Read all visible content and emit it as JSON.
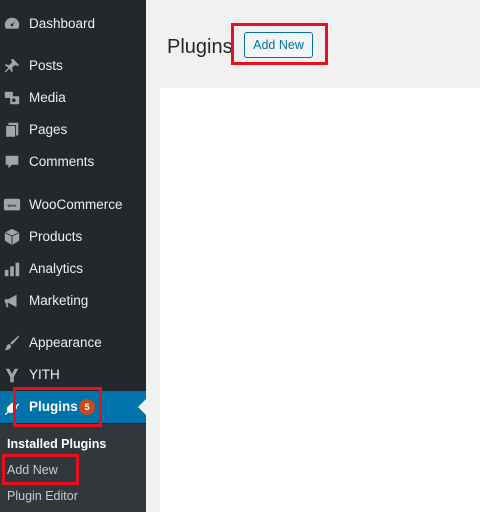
{
  "sidebar": {
    "items": [
      {
        "label": "Dashboard",
        "icon": "dashboard-icon"
      },
      {
        "label": "Posts",
        "icon": "pin-icon"
      },
      {
        "label": "Media",
        "icon": "media-icon"
      },
      {
        "label": "Pages",
        "icon": "pages-icon"
      },
      {
        "label": "Comments",
        "icon": "comment-icon"
      },
      {
        "label": "WooCommerce",
        "icon": "woocommerce-icon"
      },
      {
        "label": "Products",
        "icon": "box-icon"
      },
      {
        "label": "Analytics",
        "icon": "bar-chart-icon"
      },
      {
        "label": "Marketing",
        "icon": "megaphone-icon"
      },
      {
        "label": "Appearance",
        "icon": "paintbrush-icon"
      },
      {
        "label": "YITH",
        "icon": "yith-icon"
      },
      {
        "label": "Plugins",
        "icon": "plugin-icon",
        "badge": "5",
        "active": true
      }
    ],
    "submenu": [
      {
        "label": "Installed Plugins",
        "current": true
      },
      {
        "label": "Add New"
      },
      {
        "label": "Plugin Editor"
      }
    ]
  },
  "main": {
    "title": "Plugins",
    "add_new_label": "Add New"
  },
  "colors": {
    "sidebar_bg": "#23282d",
    "submenu_bg": "#32373c",
    "active_bg": "#0073aa",
    "badge_bg": "#ca4a1f",
    "button_color": "#0071a1",
    "highlight": "#e8101e"
  }
}
